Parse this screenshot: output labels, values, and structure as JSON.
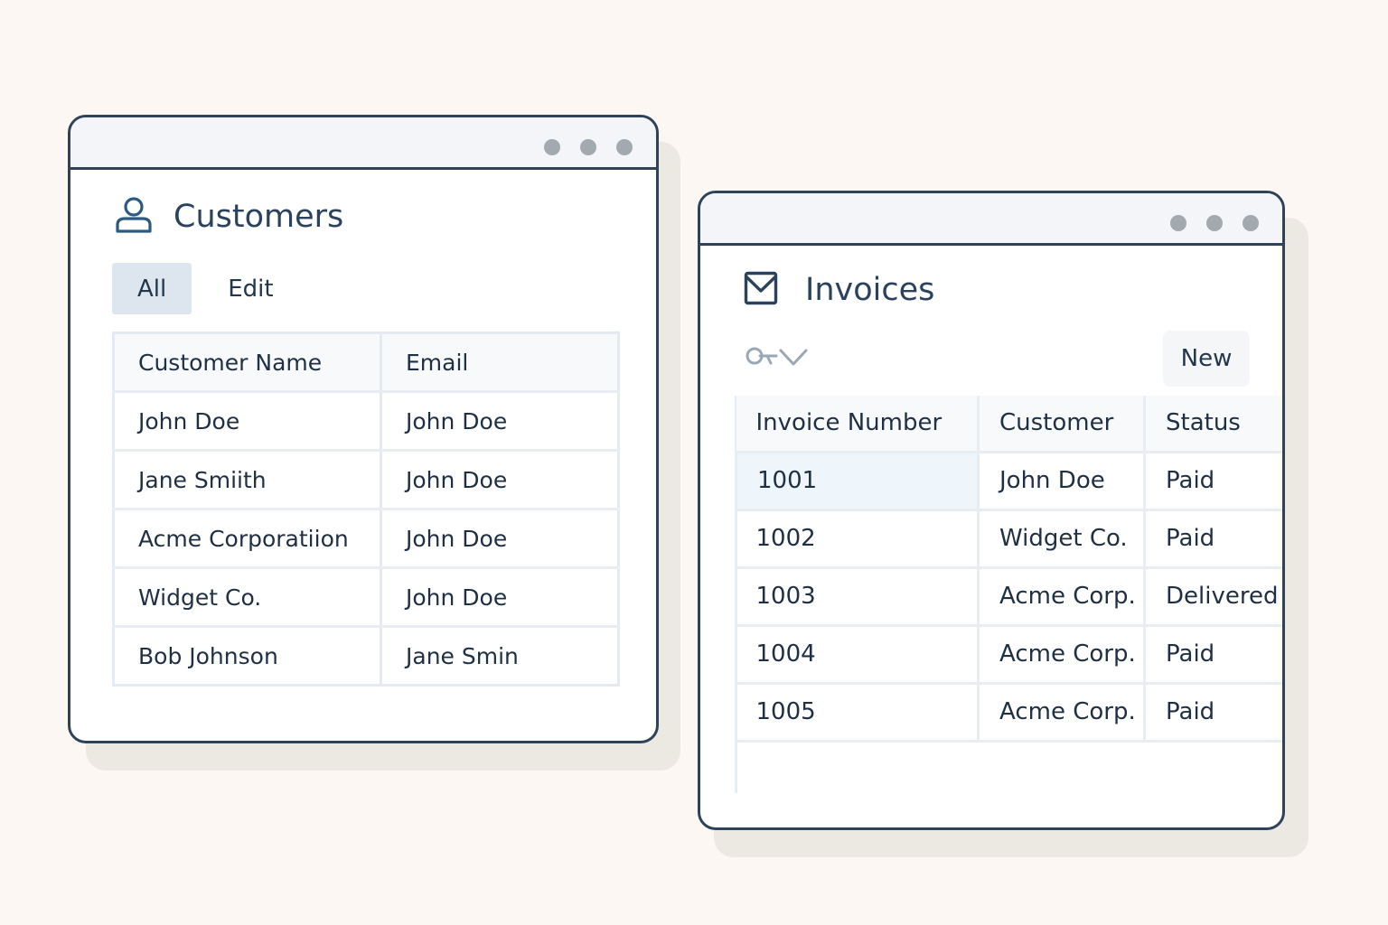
{
  "customers_window": {
    "title": "Customers",
    "icon": "user-icon",
    "tabs": [
      {
        "label": "All",
        "active": true
      },
      {
        "label": "Edit",
        "active": false
      }
    ],
    "table": {
      "columns": [
        "Customer Name",
        "Email"
      ],
      "rows": [
        [
          "John Doe",
          "John Doe"
        ],
        [
          "Jane Smiith",
          "John Doe"
        ],
        [
          "Acme Corporatiion",
          "John Doe"
        ],
        [
          "Widget Co.",
          "John Doe"
        ],
        [
          "Bob Johnson",
          "Jane Smin"
        ]
      ]
    }
  },
  "invoices_window": {
    "title": "Invoices",
    "icon": "checkbox-icon",
    "toolbar": {
      "filter_icon": "search-filter-icon",
      "dropdown_icon": "chevron-down-icon"
    },
    "new_label": "New",
    "table": {
      "columns": [
        "Invoice Number",
        "Customer",
        "Status"
      ],
      "rows": [
        [
          "1001",
          "John Doe",
          "Paid"
        ],
        [
          "1002",
          "Widget Co.",
          "Paid"
        ],
        [
          "1003",
          "Acme Corp.",
          "Delivered"
        ],
        [
          "1004",
          "Acme Corp.",
          "Paid"
        ],
        [
          "1005",
          "Acme Corp.",
          "Paid"
        ]
      ],
      "selected_row": 0
    }
  },
  "colors": {
    "background": "#fcf7f2",
    "window_border": "#2f4358",
    "titlebar": "#f3f5f8",
    "active_tab": "#dde6ee",
    "selected_cell": "#eef5fb"
  }
}
